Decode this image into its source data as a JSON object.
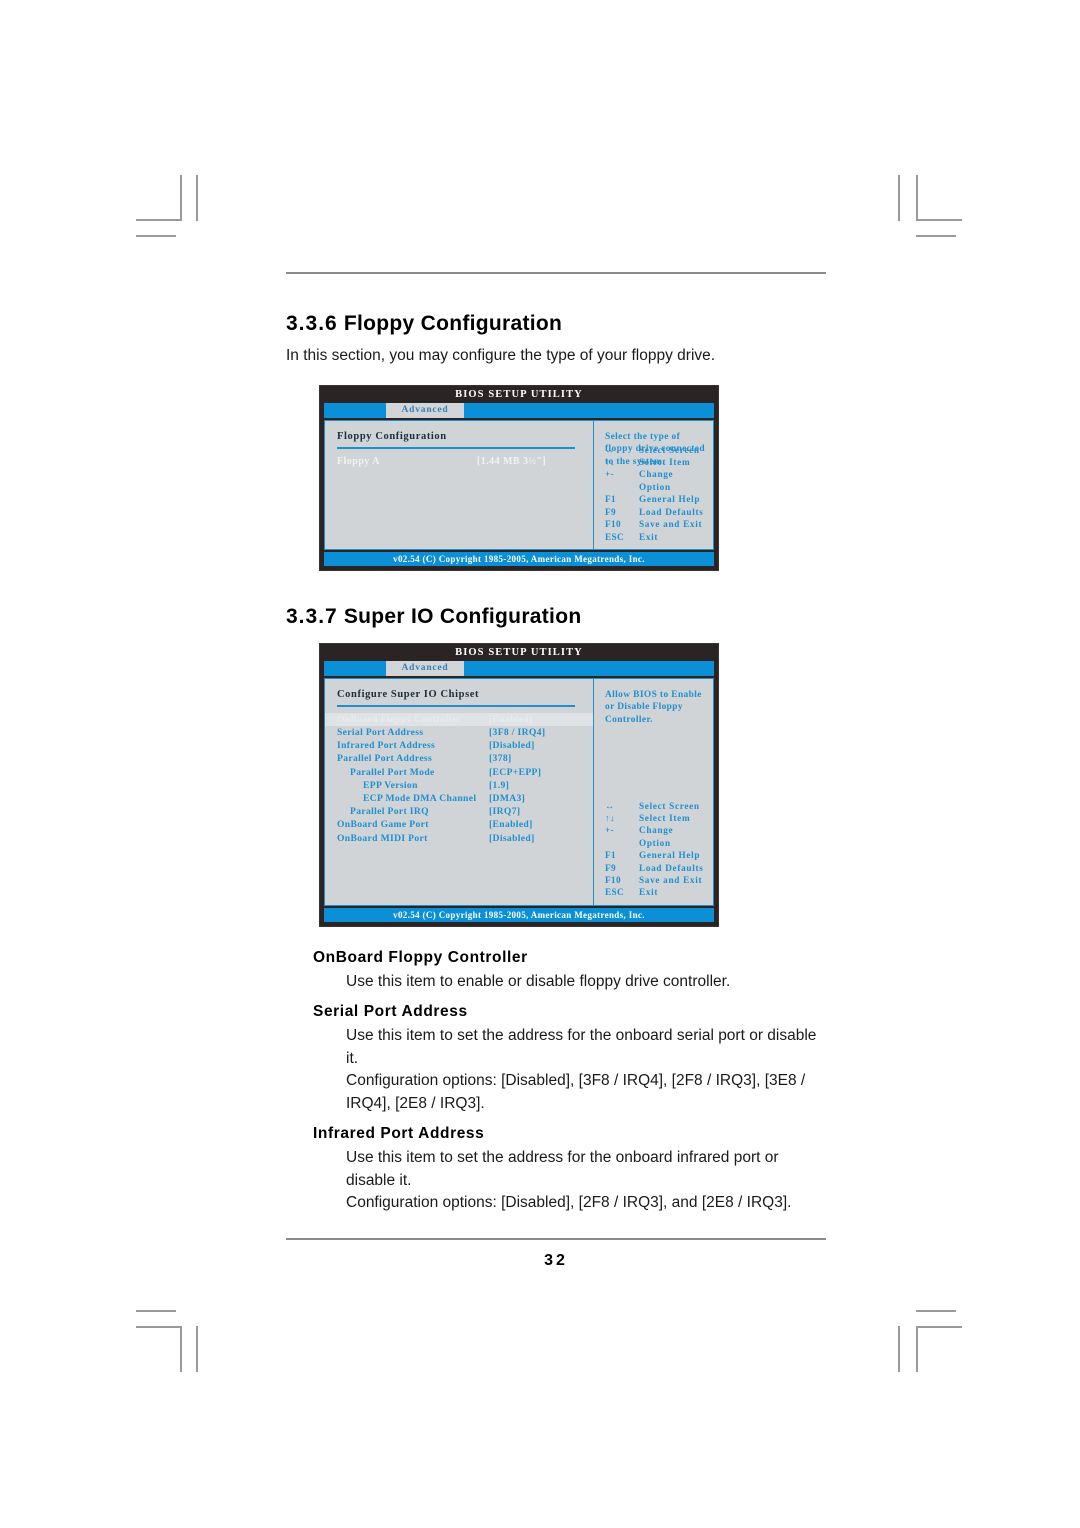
{
  "page": {
    "number": "32"
  },
  "sections": [
    {
      "number": "3.3.6",
      "title": "Floppy Configuration",
      "intro": "In this section, you may configure the type of your floppy drive."
    },
    {
      "number": "3.3.7",
      "title": "Super IO Configuration",
      "intro": ""
    }
  ],
  "bios_common": {
    "title": "BIOS SETUP UTILITY",
    "tab_active": "Advanced",
    "footer": "v02.54 (C) Copyright 1985-2005, American Megatrends, Inc.",
    "keys": [
      {
        "key": "↔",
        "desc": "Select Screen"
      },
      {
        "key": "↑↓",
        "desc": "Select Item"
      },
      {
        "key": "+-",
        "desc": "Change Option"
      },
      {
        "key": "F1",
        "desc": "General Help"
      },
      {
        "key": "F9",
        "desc": "Load Defaults"
      },
      {
        "key": "F10",
        "desc": "Save and Exit"
      },
      {
        "key": "ESC",
        "desc": "Exit"
      }
    ]
  },
  "bios_floppy": {
    "panel_heading": "Floppy Configuration",
    "rows": [
      {
        "label": "Floppy A",
        "value": "[1.44 MB 3½\"]"
      }
    ],
    "help": "Select the type of floppy drive connected to the system."
  },
  "bios_superio": {
    "panel_heading": "Configure Super IO Chipset",
    "rows": [
      {
        "label": "OnBoard Floppy Controller",
        "value": "[Enabled]",
        "indent": 0,
        "selected": true
      },
      {
        "label": "Serial Port Address",
        "value": "[3F8 / IRQ4]",
        "indent": 0,
        "selected": false
      },
      {
        "label": "Infrared Port Address",
        "value": "[Disabled]",
        "indent": 0,
        "selected": false
      },
      {
        "label": "Parallel Port Address",
        "value": "[378]",
        "indent": 0,
        "selected": false
      },
      {
        "label": "Parallel Port Mode",
        "value": "[ECP+EPP]",
        "indent": 1,
        "selected": false
      },
      {
        "label": "EPP Version",
        "value": "[1.9]",
        "indent": 2,
        "selected": false
      },
      {
        "label": "ECP Mode DMA Channel",
        "value": "[DMA3]",
        "indent": 2,
        "selected": false
      },
      {
        "label": "Parallel Port IRQ",
        "value": "[IRQ7]",
        "indent": 1,
        "selected": false
      },
      {
        "label": "OnBoard Game Port",
        "value": "[Enabled]",
        "indent": 0,
        "selected": false
      },
      {
        "label": "OnBoard MIDI Port",
        "value": "[Disabled]",
        "indent": 0,
        "selected": false
      }
    ],
    "help": "Allow BIOS to Enable or Disable Floppy Controller."
  },
  "descriptions": [
    {
      "title": "OnBoard Floppy Controller",
      "lines": [
        "Use this item to enable or disable floppy drive controller."
      ]
    },
    {
      "title": "Serial Port Address",
      "lines": [
        "Use this item to set the address for the onboard serial port or disable it.",
        "Configuration options: [Disabled], [3F8 / IRQ4], [2F8 / IRQ3], [3E8 / IRQ4], [2E8 / IRQ3]."
      ]
    },
    {
      "title": "Infrared Port Address",
      "lines": [
        "Use this item to set the address for the onboard infrared port or disable it.",
        "Configuration options: [Disabled], [2F8 / IRQ3], and [2E8 / IRQ3]."
      ]
    }
  ],
  "colors": {
    "accent_blue": "#1f8fd0",
    "tab_blue": "#0b8fd6",
    "panel_bg": "#d0d4d6",
    "title_bar": "#2a2524"
  }
}
